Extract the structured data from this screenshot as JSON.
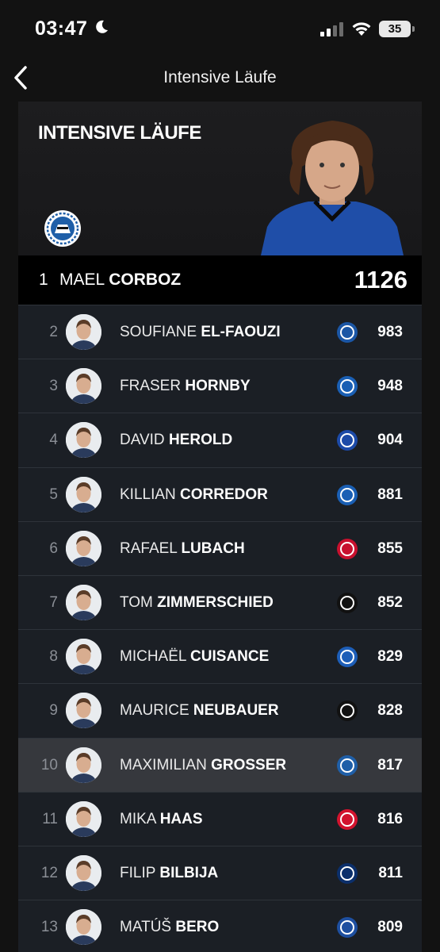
{
  "status": {
    "time": "03:47",
    "battery": "35"
  },
  "nav": {
    "title": "Intensive Läufe"
  },
  "hero": {
    "title": "INTENSIVE LÄUFE"
  },
  "leader": {
    "rank": "1",
    "first": "MAEL",
    "last": "CORBOZ",
    "value": "1126"
  },
  "rows": [
    {
      "rank": "2",
      "first": "SOUFIANE",
      "last": "EL-FAOUZI",
      "value": "983",
      "club_icon": "schalke-crest-icon"
    },
    {
      "rank": "3",
      "first": "FRASER",
      "last": "HORNBY",
      "value": "948",
      "club_icon": "darmstadt-crest-icon"
    },
    {
      "rank": "4",
      "first": "DAVID",
      "last": "HEROLD",
      "value": "904",
      "club_icon": "ksc-crest-icon"
    },
    {
      "rank": "5",
      "first": "KILLIAN",
      "last": "CORREDOR",
      "value": "881",
      "club_icon": "darmstadt-crest-icon"
    },
    {
      "rank": "6",
      "first": "RAFAEL",
      "last": "LUBACH",
      "value": "855",
      "club_icon": "nuernberg-crest-icon"
    },
    {
      "rank": "7",
      "first": "TOM",
      "last": "ZIMMERSCHIED",
      "value": "852",
      "club_icon": "elversberg-crest-icon"
    },
    {
      "rank": "8",
      "first": "MICHAËL",
      "last": "CUISANCE",
      "value": "829",
      "club_icon": "hertha-crest-icon"
    },
    {
      "rank": "9",
      "first": "MAURICE",
      "last": "NEUBAUER",
      "value": "828",
      "club_icon": "hannover-crest-icon"
    },
    {
      "rank": "10",
      "first": "MAXIMILIAN",
      "last": "GROSSER",
      "value": "817",
      "club_icon": "bielefeld-crest-icon"
    },
    {
      "rank": "11",
      "first": "MIKA",
      "last": "HAAS",
      "value": "816",
      "club_icon": "kaiserslautern-crest-icon"
    },
    {
      "rank": "12",
      "first": "FILIP",
      "last": "BILBIJA",
      "value": "811",
      "club_icon": "paderborn-crest-icon"
    },
    {
      "rank": "13",
      "first": "MATÚŠ",
      "last": "BERO",
      "value": "809",
      "club_icon": "bochum-crest-icon"
    }
  ]
}
